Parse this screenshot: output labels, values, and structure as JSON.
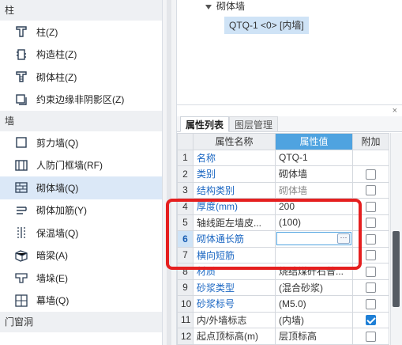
{
  "nav": {
    "sections": {
      "column": "柱",
      "wall": "墙",
      "door_window": "门窗洞"
    },
    "column_items": [
      {
        "label": "柱(Z)",
        "icon": "column-icon"
      },
      {
        "label": "构造柱(Z)",
        "icon": "construct-column-icon"
      },
      {
        "label": "砌体柱(Z)",
        "icon": "masonry-column-icon"
      },
      {
        "label": "约束边缘非阴影区(Z)",
        "icon": "constraint-edge-icon"
      }
    ],
    "wall_items": [
      {
        "label": "剪力墙(Q)",
        "icon": "shear-wall-icon"
      },
      {
        "label": "人防门框墙(RF)",
        "icon": "civil-defense-door-wall-icon"
      },
      {
        "label": "砌体墙(Q)",
        "icon": "masonry-wall-icon",
        "active": true
      },
      {
        "label": "砌体加筋(Y)",
        "icon": "masonry-rebar-icon"
      },
      {
        "label": "保温墙(Q)",
        "icon": "insulation-wall-icon"
      },
      {
        "label": "暗梁(A)",
        "icon": "hidden-beam-icon"
      },
      {
        "label": "墙垛(E)",
        "icon": "wall-pier-icon"
      },
      {
        "label": "幕墙(Q)",
        "icon": "curtain-wall-icon"
      }
    ]
  },
  "tree": {
    "parent": "砌体墙",
    "child": "QTQ-1 <0> [内墙]"
  },
  "props": {
    "close": "×",
    "tabs": [
      "属性列表",
      "图层管理"
    ],
    "headers": {
      "name": "属性名称",
      "value": "属性值",
      "extra": "附加"
    },
    "rows": [
      {
        "num": "1",
        "name": "名称",
        "value": "QTQ-1",
        "blue": true,
        "check": null
      },
      {
        "num": "2",
        "name": "类别",
        "value": "砌体墙",
        "blue": true,
        "check": false
      },
      {
        "num": "3",
        "name": "结构类别",
        "value": "砌体墙",
        "blue": true,
        "gray": true,
        "check": false
      },
      {
        "num": "4",
        "name": "厚度(mm)",
        "value": "200",
        "blue": true,
        "check": false
      },
      {
        "num": "5",
        "name": "轴线距左墙皮...",
        "value": "(100)",
        "blue": false,
        "check": false
      },
      {
        "num": "6",
        "name": "砌体通长筋",
        "value": "",
        "blue": true,
        "editing": true,
        "selected": true,
        "check": false
      },
      {
        "num": "7",
        "name": "横向短筋",
        "value": "",
        "blue": true,
        "check": false
      },
      {
        "num": "8",
        "name": "材质",
        "value": "烧结煤矸石普...",
        "blue": true,
        "check": false
      },
      {
        "num": "9",
        "name": "砂浆类型",
        "value": "(混合砂浆)",
        "blue": true,
        "check": false
      },
      {
        "num": "10",
        "name": "砂浆标号",
        "value": "(M5.0)",
        "blue": true,
        "check": false
      },
      {
        "num": "11",
        "name": "内/外墙标志",
        "value": "(内墙)",
        "blue": false,
        "check": true
      },
      {
        "num": "12",
        "name": "起点顶标高(m)",
        "value": "层顶标高",
        "blue": false,
        "check": false
      }
    ],
    "edit_button": "···"
  },
  "colors": {
    "accent": "#4fa3e0",
    "highlight": "#e51f1f",
    "active_row": "#dbe8f7"
  }
}
